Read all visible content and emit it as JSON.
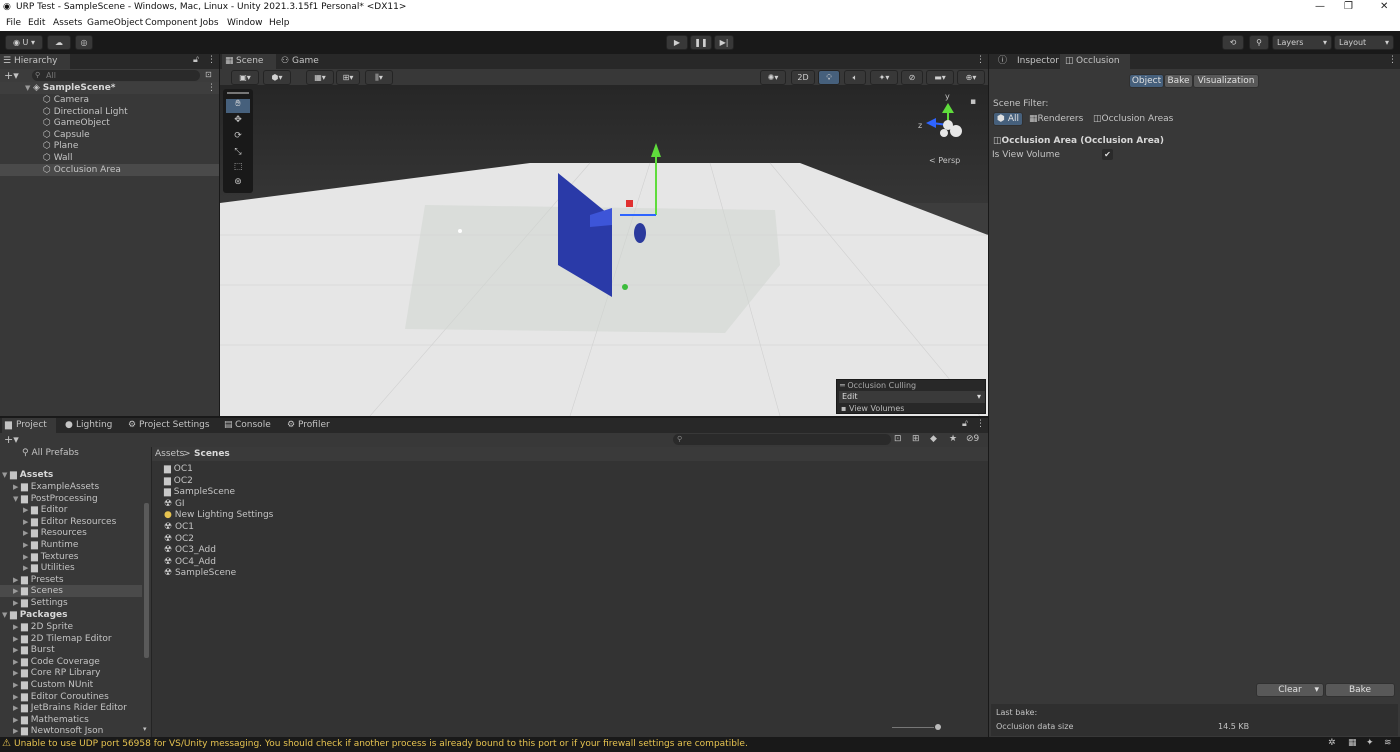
{
  "window": {
    "title": "URP Test - SampleScene - Windows, Mac, Linux - Unity 2021.3.15f1 Personal* <DX11>"
  },
  "menu": [
    "File",
    "Edit",
    "Assets",
    "GameObject",
    "Component",
    "Jobs",
    "Window",
    "Help"
  ],
  "toolbar": {
    "account": "U",
    "layers": "Layers",
    "layout": "Layout"
  },
  "hierarchy": {
    "tab": "Hierarchy",
    "search_placeholder": "All",
    "scene": "SampleScene*",
    "items": [
      "Camera",
      "Directional Light",
      "GameObject",
      "Capsule",
      "Plane",
      "Wall",
      "Occlusion Area"
    ]
  },
  "scene_tabs": {
    "scene": "Scene",
    "game": "Game"
  },
  "scene_view": {
    "toggle_2d": "2D",
    "persp": "Persp",
    "axis_y": "y",
    "axis_z": "z"
  },
  "occlusion_overlay": {
    "title": "Occlusion Culling",
    "mode": "Edit",
    "option": "View Volumes"
  },
  "inspector": {
    "tab_inspector": "Inspector",
    "tab_occlusion": "Occlusion"
  },
  "occlusion": {
    "modes": [
      "Object",
      "Bake",
      "Visualization"
    ],
    "scene_filter_label": "Scene Filter:",
    "filters": [
      "All",
      "Renderers",
      "Occlusion Areas"
    ],
    "component": "Occlusion Area (Occlusion Area)",
    "field_label": "Is View Volume",
    "field_value": "✔",
    "clear": "Clear",
    "bake": "Bake",
    "last_bake_label": "Last bake:",
    "data_size_label": "Occlusion data size",
    "data_size_value": "14.5 KB"
  },
  "bottom_tabs": [
    "Project",
    "Lighting",
    "Project Settings",
    "Console",
    "Profiler"
  ],
  "project": {
    "favorites": "All Prefabs",
    "assets_header": "Assets",
    "tree": [
      {
        "label": "ExampleAssets",
        "indent": 1
      },
      {
        "label": "PostProcessing",
        "indent": 1,
        "open": true
      },
      {
        "label": "Editor",
        "indent": 2
      },
      {
        "label": "Editor Resources",
        "indent": 2
      },
      {
        "label": "Resources",
        "indent": 2
      },
      {
        "label": "Runtime",
        "indent": 2
      },
      {
        "label": "Textures",
        "indent": 2
      },
      {
        "label": "Utilities",
        "indent": 2
      },
      {
        "label": "Presets",
        "indent": 1
      },
      {
        "label": "Scenes",
        "indent": 1,
        "selected": true
      },
      {
        "label": "Settings",
        "indent": 1
      }
    ],
    "packages_header": "Packages",
    "packages": [
      "2D Sprite",
      "2D Tilemap Editor",
      "Burst",
      "Code Coverage",
      "Core RP Library",
      "Custom NUnit",
      "Editor Coroutines",
      "JetBrains Rider Editor",
      "Mathematics",
      "Newtonsoft Json"
    ],
    "breadcrumb": [
      "Assets",
      "Scenes"
    ],
    "files": [
      {
        "name": "OC1",
        "kind": "folder"
      },
      {
        "name": "OC2",
        "kind": "folder"
      },
      {
        "name": "SampleScene",
        "kind": "folder"
      },
      {
        "name": "GI",
        "kind": "scene"
      },
      {
        "name": "New Lighting Settings",
        "kind": "lighting"
      },
      {
        "name": "OC1",
        "kind": "scene"
      },
      {
        "name": "OC2",
        "kind": "scene"
      },
      {
        "name": "OC3_Add",
        "kind": "scene"
      },
      {
        "name": "OC4_Add",
        "kind": "scene"
      },
      {
        "name": "SampleScene",
        "kind": "scene"
      }
    ],
    "hidden_count": "9"
  },
  "status": {
    "message": "Unable to use UDP port 56958 for VS/Unity messaging. You should check if another process is already bound to this port or if your firewall settings are compatible."
  },
  "colors": {
    "accent": "#46607c",
    "warning": "#e6c350",
    "selection": "#4a4a4a",
    "folder": "#c8c8c8"
  }
}
